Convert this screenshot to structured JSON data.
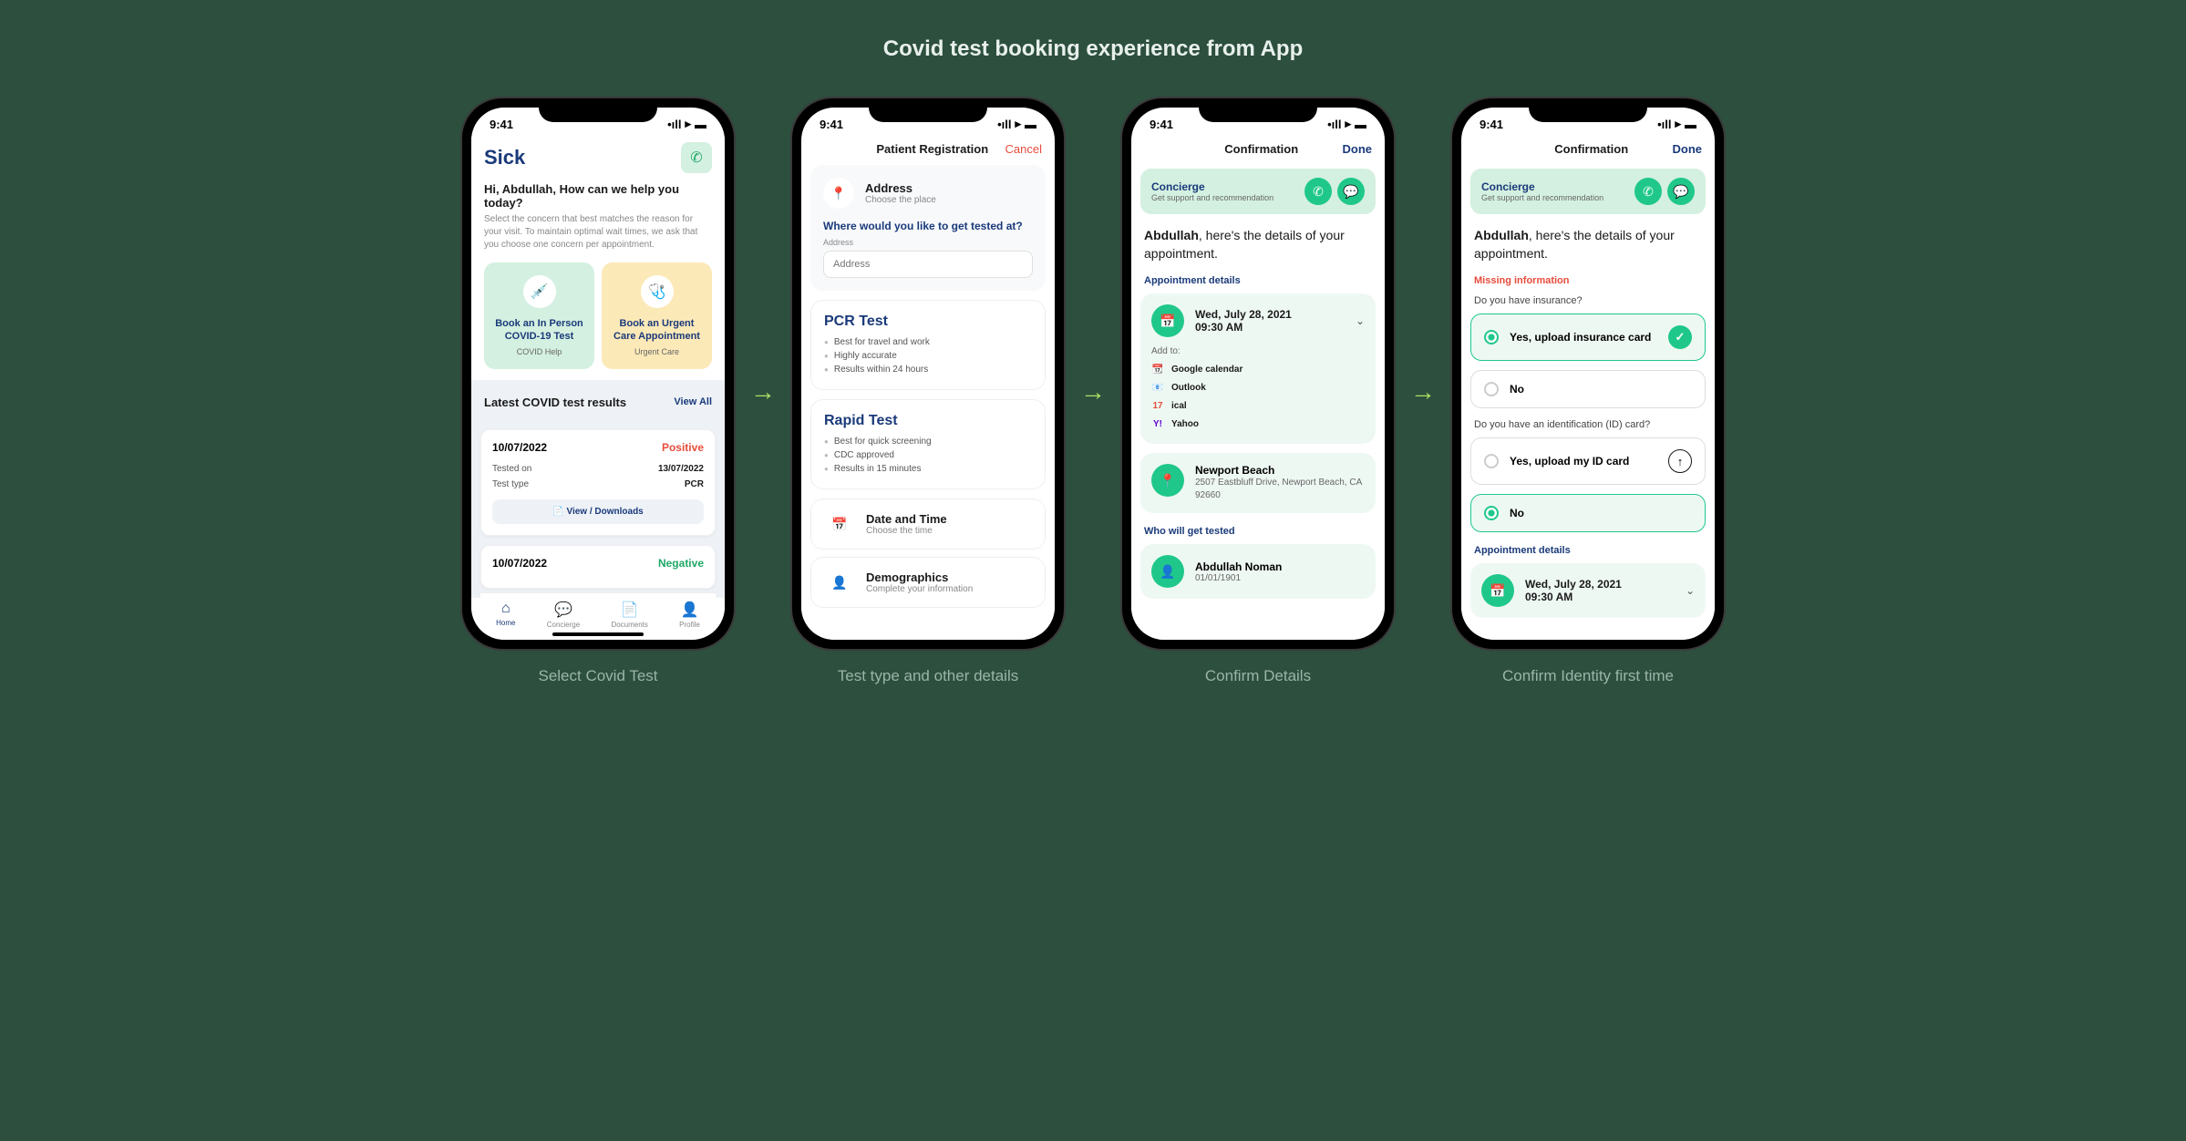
{
  "page_title": "Covid test booking experience from App",
  "status_time": "9:41",
  "captions": [
    "Select Covid Test",
    "Test type and other details",
    "Confirm Details",
    "Confirm Identity first time"
  ],
  "screen1": {
    "logo": "Sick",
    "greeting": "Hi, Abdullah, How can we help you today?",
    "sub": "Select the concern that best matches the reason for your visit. To maintain optimal wait times, we ask that you choose one concern per appointment.",
    "card1_title": "Book an In Person COVID-19 Test",
    "card1_sub": "COVID Help",
    "card2_title": "Book an Urgent Care Appointment",
    "card2_sub": "Urgent Care",
    "results_title": "Latest COVID test results",
    "view_all": "View All",
    "result": {
      "date": "10/07/2022",
      "status": "Positive",
      "tested_label": "Tested on",
      "tested_val": "13/07/2022",
      "type_label": "Test type",
      "type_val": "PCR",
      "download": "View / Downloads"
    },
    "result2_date": "10/07/2022",
    "result2_status": "Negative",
    "nav": [
      "Home",
      "Concierge",
      "Documents",
      "Profile"
    ]
  },
  "screen2": {
    "title": "Patient Registration",
    "cancel": "Cancel",
    "address_label": "Address",
    "address_sub": "Choose the place",
    "prompt": "Where would you like to get tested at?",
    "field_label": "Address",
    "placeholder": "Address",
    "pcr_title": "PCR Test",
    "pcr_bullets": [
      "Best for travel and work",
      "Highly accurate",
      "Results within 24 hours"
    ],
    "rapid_title": "Rapid Test",
    "rapid_bullets": [
      "Best for quick screening",
      "CDC approved",
      "Results in 15 minutes"
    ],
    "datetime_label": "Date and Time",
    "datetime_sub": "Choose the time",
    "demo_label": "Demographics",
    "demo_sub": "Complete your information"
  },
  "screen3": {
    "title": "Confirmation",
    "done": "Done",
    "concierge": "Concierge",
    "concierge_sub": "Get support and recommendation",
    "detail_name": "Abdullah",
    "detail_rest": ", here's the details of your appointment.",
    "appt_label": "Appointment details",
    "appt_date": "Wed, July 28, 2021",
    "appt_time": "09:30 AM",
    "addto": "Add to:",
    "calendars": [
      "Google calendar",
      "Outlook",
      "ical",
      "Yahoo"
    ],
    "loc_name": "Newport Beach",
    "loc_addr": "2507 Eastbluff Drive, Newport Beach, CA 92660",
    "who_label": "Who will get tested",
    "person_name": "Abdullah Noman",
    "person_dob": "01/01/1901"
  },
  "screen4": {
    "title": "Confirmation",
    "done": "Done",
    "concierge": "Concierge",
    "concierge_sub": "Get support and recommendation",
    "detail_name": "Abdullah",
    "detail_rest": ", here's the details of your appointment.",
    "missing_label": "Missing information",
    "q1": "Do you have insurance?",
    "q1_yes": "Yes, upload insurance card",
    "q1_no": "No",
    "q2": "Do you have an identification (ID) card?",
    "q2_yes": "Yes, upload my ID card",
    "q2_no": "No",
    "appt_label": "Appointment details",
    "appt_date": "Wed, July 28, 2021",
    "appt_time": "09:30 AM"
  }
}
